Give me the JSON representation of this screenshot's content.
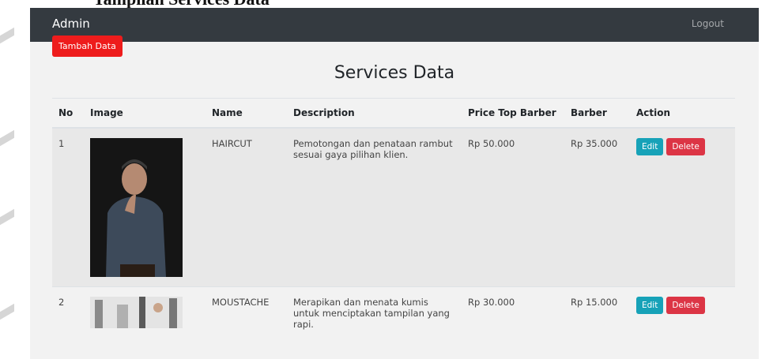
{
  "caption": {
    "visible_text": "Tampilan Services Data"
  },
  "navbar": {
    "brand": "Admin",
    "logout_label": "Logout"
  },
  "toolbar": {
    "add_label": "Tambah Data"
  },
  "page": {
    "title": "Services Data"
  },
  "table": {
    "headers": [
      "No",
      "Image",
      "Name",
      "Description",
      "Price Top Barber",
      "Barber",
      "Action"
    ],
    "rows": [
      {
        "no": "1",
        "image": "haircut-photo",
        "name": "HAIRCUT",
        "description": "Pemotongan dan penataan rambut sesuai gaya pilihan klien.",
        "price_top": "Rp 50.000",
        "price_barber": "Rp 35.000",
        "edit_label": "Edit",
        "delete_label": "Delete"
      },
      {
        "no": "2",
        "image": "moustache-photo",
        "name": "MOUSTACHE",
        "description": "Merapikan dan menata kumis untuk menciptakan tampilan yang rapi.",
        "price_top": "Rp 30.000",
        "price_barber": "Rp 15.000",
        "edit_label": "Edit",
        "delete_label": "Delete"
      }
    ]
  },
  "colors": {
    "navbar": "#343a40",
    "add_button": "#ee1c1c",
    "edit_button": "#17a2b8",
    "delete_button": "#dc3545",
    "row_highlight": "#e8e8e8"
  }
}
